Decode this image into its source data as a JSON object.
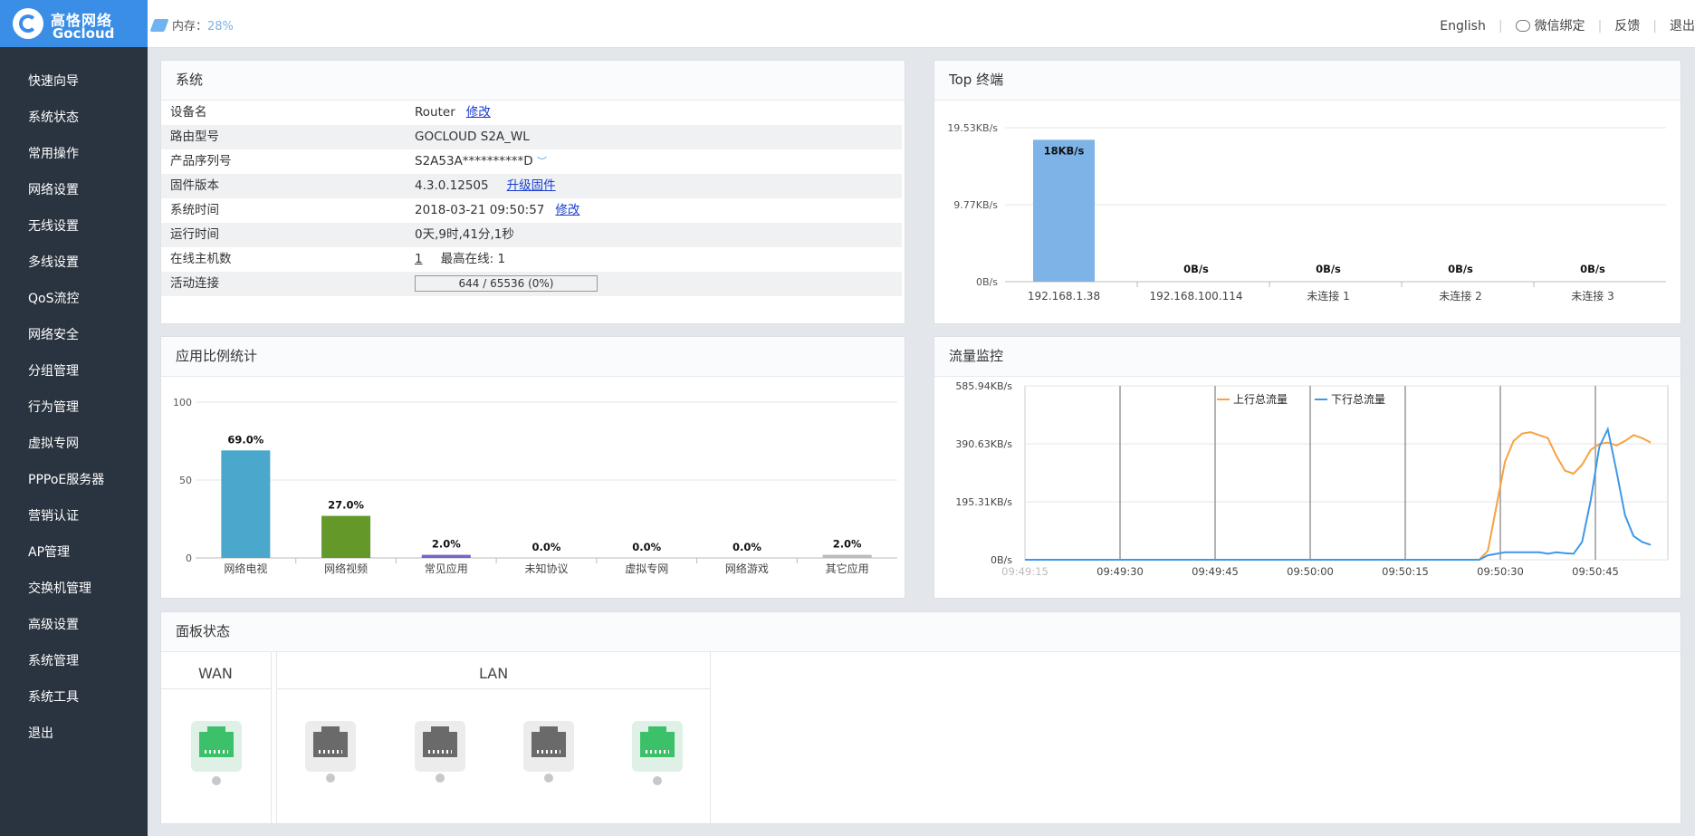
{
  "header": {
    "brand_cn": "高恪网络",
    "brand_en": "Gocloud",
    "memory_label": "内存：",
    "memory_value": "28%",
    "links": {
      "english": "English",
      "wechat": "微信绑定",
      "feedback": "反馈",
      "logout": "退出"
    }
  },
  "sidebar": {
    "items": [
      {
        "label": "快速向导"
      },
      {
        "label": "系统状态"
      },
      {
        "label": "常用操作"
      },
      {
        "label": "网络设置"
      },
      {
        "label": "无线设置"
      },
      {
        "label": "多线设置"
      },
      {
        "label": "QoS流控"
      },
      {
        "label": "网络安全"
      },
      {
        "label": "分组管理"
      },
      {
        "label": "行为管理"
      },
      {
        "label": "虚拟专网"
      },
      {
        "label": "PPPoE服务器"
      },
      {
        "label": "营销认证"
      },
      {
        "label": "AP管理"
      },
      {
        "label": "交换机管理"
      },
      {
        "label": "高级设置"
      },
      {
        "label": "系统管理"
      },
      {
        "label": "系统工具"
      },
      {
        "label": "退出"
      }
    ]
  },
  "system": {
    "title": "系统",
    "rows": [
      {
        "key": "设备名",
        "value": "Router",
        "link": "修改"
      },
      {
        "key": "路由型号",
        "value": "GOCLOUD S2A_WL"
      },
      {
        "key": "产品序列号",
        "value": "S2A53A**********D"
      },
      {
        "key": "固件版本",
        "value": "4.3.0.12505",
        "link": "升级固件"
      },
      {
        "key": "系统时间",
        "value": "2018-03-21 09:50:57",
        "link": "修改"
      },
      {
        "key": "运行时间",
        "value": "0天,9时,41分,1秒"
      },
      {
        "key": "在线主机数",
        "value": "1",
        "extra_label": "最高在线:",
        "extra_value": "1"
      },
      {
        "key": "活动连接",
        "value": "644 / 65536 (0%)"
      }
    ]
  },
  "top_terminals": {
    "title": "Top 终端",
    "chart_data": {
      "type": "bar",
      "categories": [
        "192.168.1.38",
        "192.168.100.114",
        "未连接 1",
        "未连接 2",
        "未连接 3"
      ],
      "values": [
        18,
        0,
        0,
        0,
        0
      ],
      "data_labels": [
        "18KB/s",
        "0B/s",
        "0B/s",
        "0B/s",
        "0B/s"
      ],
      "y_ticks": [
        "0B/s",
        "9.77KB/s",
        "19.53KB/s"
      ],
      "ylim": [
        0,
        19.53
      ],
      "color": "#7eb3e8"
    }
  },
  "app_stats": {
    "title": "应用比例统计",
    "chart_data": {
      "type": "bar",
      "categories": [
        "网络电视",
        "网络视频",
        "常见应用",
        "未知协议",
        "虚拟专网",
        "网络游戏",
        "其它应用"
      ],
      "values": [
        69.0,
        27.0,
        2.0,
        0.0,
        0.0,
        0.0,
        2.0
      ],
      "data_labels": [
        "69.0%",
        "27.0%",
        "2.0%",
        "0.0%",
        "0.0%",
        "0.0%",
        "2.0%"
      ],
      "colors": [
        "#4aa8cc",
        "#64992a",
        "#7a63c6",
        "#cccccc",
        "#cccccc",
        "#cccccc",
        "#bbbbbb"
      ],
      "y_ticks": [
        "0",
        "50",
        "100"
      ],
      "ylim": [
        0,
        100
      ]
    }
  },
  "traffic": {
    "title": "流量监控",
    "chart_data": {
      "type": "line",
      "x_ticks": [
        "09:49:15",
        "09:49:30",
        "09:49:45",
        "09:50:00",
        "09:50:15",
        "09:50:30",
        "09:50:45"
      ],
      "y_ticks": [
        "0B/s",
        "195.31KB/s",
        "390.63KB/s",
        "585.94KB/s"
      ],
      "ylim": [
        0,
        585.94
      ],
      "xlim": [
        0,
        75
      ],
      "series": [
        {
          "name": "上行总流量",
          "color": "#f5a340",
          "points": [
            [
              0,
              0
            ],
            [
              10,
              0
            ],
            [
              20,
              0
            ],
            [
              30,
              0
            ],
            [
              40,
              0
            ],
            [
              50,
              0
            ],
            [
              53,
              0
            ],
            [
              54,
              30
            ],
            [
              55,
              180
            ],
            [
              56,
              330
            ],
            [
              57,
              400
            ],
            [
              58,
              425
            ],
            [
              59,
              430
            ],
            [
              60,
              420
            ],
            [
              61,
              410
            ],
            [
              62,
              350
            ],
            [
              63,
              300
            ],
            [
              64,
              290
            ],
            [
              65,
              320
            ],
            [
              66,
              370
            ],
            [
              67,
              390
            ],
            [
              68,
              395
            ],
            [
              69,
              385
            ],
            [
              70,
              400
            ],
            [
              71,
              420
            ],
            [
              72,
              410
            ],
            [
              73,
              395
            ]
          ]
        },
        {
          "name": "下行总流量",
          "color": "#3f98e8",
          "points": [
            [
              0,
              0
            ],
            [
              10,
              0
            ],
            [
              20,
              0
            ],
            [
              30,
              0
            ],
            [
              40,
              0
            ],
            [
              50,
              0
            ],
            [
              53,
              0
            ],
            [
              54,
              15
            ],
            [
              56,
              25
            ],
            [
              58,
              25
            ],
            [
              60,
              25
            ],
            [
              61,
              20
            ],
            [
              62,
              25
            ],
            [
              63,
              22
            ],
            [
              64,
              20
            ],
            [
              65,
              60
            ],
            [
              66,
              200
            ],
            [
              67,
              380
            ],
            [
              68,
              440
            ],
            [
              69,
              300
            ],
            [
              70,
              150
            ],
            [
              71,
              80
            ],
            [
              72,
              60
            ],
            [
              73,
              50
            ]
          ]
        }
      ]
    }
  },
  "panel_status": {
    "title": "面板状态",
    "wan_label": "WAN",
    "lan_label": "LAN",
    "ports": [
      {
        "group": "WAN",
        "state": "on"
      },
      {
        "group": "LAN",
        "state": "off"
      },
      {
        "group": "LAN",
        "state": "off"
      },
      {
        "group": "LAN",
        "state": "off"
      },
      {
        "group": "LAN",
        "state": "on"
      }
    ]
  }
}
